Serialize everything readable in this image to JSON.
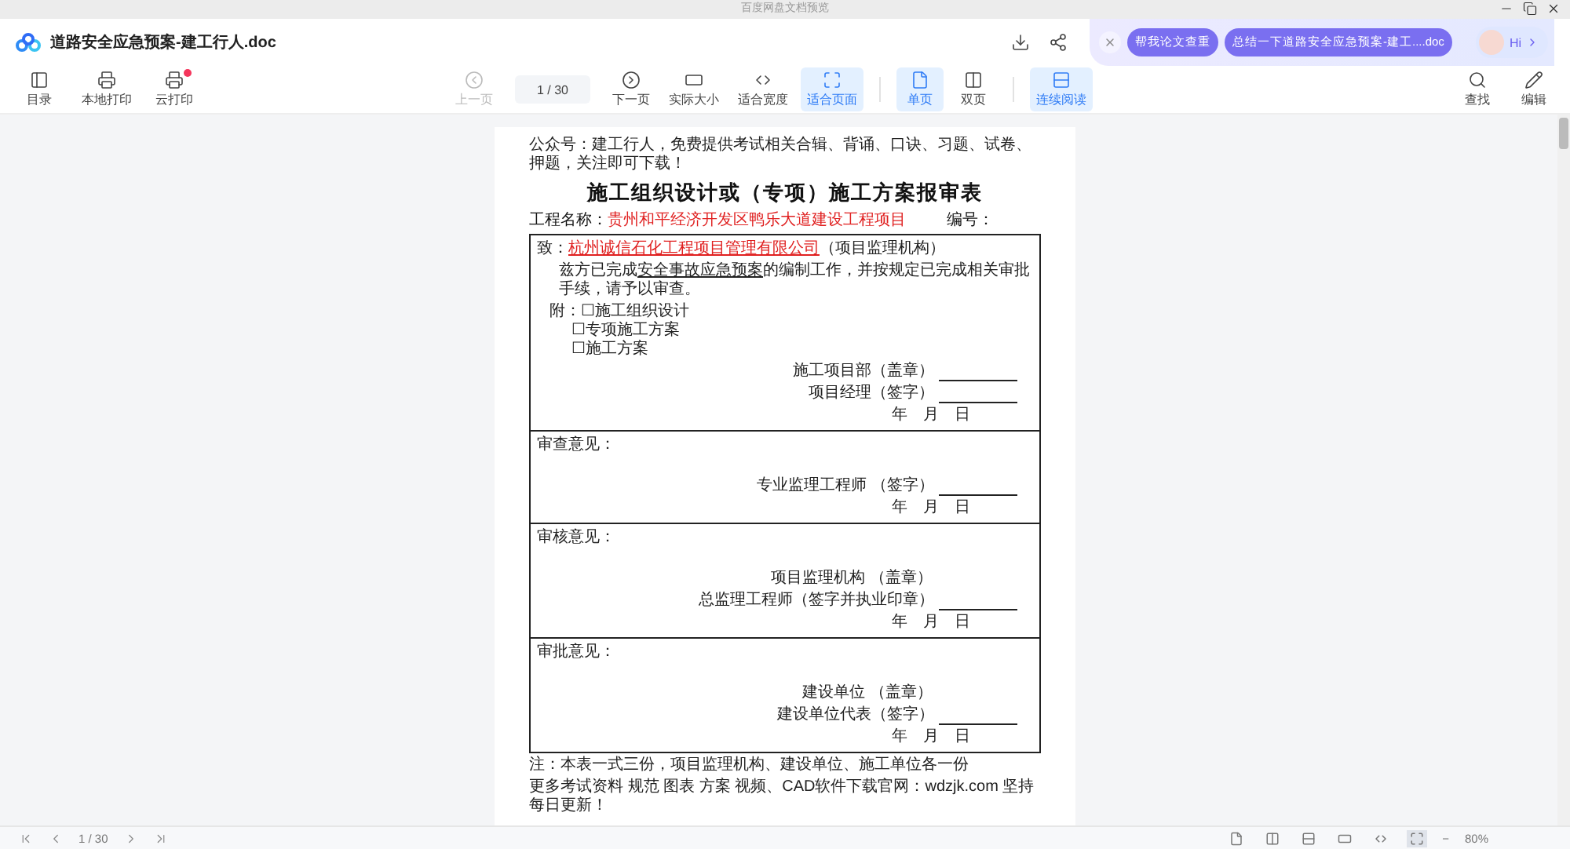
{
  "window": {
    "title": "百度网盘文档预览"
  },
  "header": {
    "filename": "道路安全应急预案-建工行人.doc"
  },
  "assistant": {
    "chips": [
      "帮我论文查重",
      "总结一下道路安全应急预案-建工....doc"
    ],
    "greeting": "Hi"
  },
  "toolbar": {
    "left": [
      {
        "label": "目录",
        "badge": false
      },
      {
        "label": "本地打印",
        "badge": false
      },
      {
        "label": "云打印",
        "badge": true
      }
    ],
    "center": [
      {
        "kind": "button",
        "label": "上一页",
        "disabled": true,
        "selected": false
      },
      {
        "kind": "page",
        "value": "1 / 30"
      },
      {
        "kind": "button",
        "label": "下一页",
        "disabled": false,
        "selected": false
      },
      {
        "kind": "button",
        "label": "实际大小",
        "disabled": false,
        "selected": false
      },
      {
        "kind": "button",
        "label": "适合宽度",
        "disabled": false,
        "selected": false
      },
      {
        "kind": "button",
        "label": "适合页面",
        "disabled": false,
        "selected": true
      },
      {
        "kind": "divider"
      },
      {
        "kind": "button",
        "label": "单页",
        "disabled": false,
        "selected": true
      },
      {
        "kind": "button",
        "label": "双页",
        "disabled": false,
        "selected": false
      },
      {
        "kind": "divider"
      },
      {
        "kind": "button",
        "label": "连续阅读",
        "disabled": false,
        "selected": true
      }
    ],
    "right": [
      {
        "label": "查找"
      },
      {
        "label": "编辑"
      }
    ]
  },
  "document": {
    "header_note": "公众号：建工行人，免费提供考试相关合辑、背诵、口诀、习题、试卷、押题，关注即可下载！",
    "title": "施工组织设计或（专项）施工方案报审表",
    "project_label": "工程名称：",
    "project_name": "贵州和平经济开发区鸭乐大道建设工程项目",
    "number_label": "编号：",
    "sections": [
      {
        "lines": [
          {
            "kind": "addressee",
            "prefix": "致：",
            "org": "杭州诚信石化工程项目管理有限公司",
            "suffix": "（项目监理机构）"
          },
          {
            "kind": "statement",
            "before": "兹方已完成",
            "fill": "安全事故应急预案",
            "after": "的编制工作，并按规定已完成相关审批手续，请予以审查。"
          },
          {
            "kind": "attach",
            "prefix": "附：",
            "items": [
              "☐施工组织设计",
              "☐专项施工方案",
              "☐施工方案"
            ]
          },
          {
            "kind": "sign",
            "label": "施工项目部（盖章）"
          },
          {
            "kind": "sign",
            "label": "项目经理（签字）"
          },
          {
            "kind": "date",
            "label": "年　月　日"
          }
        ]
      },
      {
        "lines": [
          {
            "kind": "heading",
            "label": "审查意见："
          },
          {
            "kind": "sign",
            "label": "专业监理工程师 （签字）"
          },
          {
            "kind": "date",
            "label": "年　月　日"
          }
        ]
      },
      {
        "lines": [
          {
            "kind": "heading",
            "label": "审核意见："
          },
          {
            "kind": "stamp",
            "label": "项目监理机构 （盖章）"
          },
          {
            "kind": "sign",
            "label": "总监理工程师（签字并执业印章）"
          },
          {
            "kind": "date",
            "label": "年　月　日"
          }
        ]
      },
      {
        "lines": [
          {
            "kind": "heading",
            "label": "审批意见："
          },
          {
            "kind": "stamp",
            "label": "建设单位 （盖章）"
          },
          {
            "kind": "sign",
            "label": "建设单位代表（签字）"
          },
          {
            "kind": "date",
            "label": "年　月　日"
          }
        ]
      }
    ],
    "note": "注：本表一式三份，项目监理机构、建设单位、施工单位各一份",
    "footer": "更多考试资料 规范 图表 方案 视频、CAD软件下载官网：wdzjk.com 坚持每日更新！"
  },
  "bottom_bar": {
    "page": "1 / 30",
    "views": [
      {
        "selected": false
      },
      {
        "selected": false
      },
      {
        "selected": false
      },
      {
        "selected": false
      },
      {
        "selected": false
      },
      {
        "selected": true
      }
    ],
    "zoom_out": "−",
    "zoom": "80%"
  }
}
